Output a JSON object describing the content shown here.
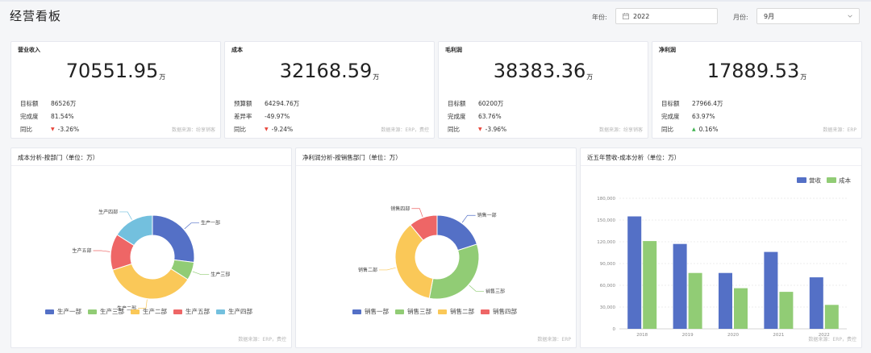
{
  "page": {
    "title": "经营看板"
  },
  "filters": {
    "year_label": "年份:",
    "year_value": "2022",
    "month_label": "月份:",
    "month_value": "9月"
  },
  "kpis": [
    {
      "title": "营业收入",
      "value": "70551.95",
      "unit": "万",
      "rows": [
        {
          "label": "目标额",
          "value": "86526万",
          "trend": ""
        },
        {
          "label": "完成度",
          "value": "81.54%",
          "trend": ""
        },
        {
          "label": "同比",
          "value": "-3.26%",
          "trend": "down"
        }
      ],
      "source": "数据来源：纷享销客"
    },
    {
      "title": "成本",
      "value": "32168.59",
      "unit": "万",
      "rows": [
        {
          "label": "预算额",
          "value": "64294.76万",
          "trend": ""
        },
        {
          "label": "差异率",
          "value": "-49.97%",
          "trend": ""
        },
        {
          "label": "同比",
          "value": "-9.24%",
          "trend": "down"
        }
      ],
      "source": "数据来源：ERP，费控"
    },
    {
      "title": "毛利润",
      "value": "38383.36",
      "unit": "万",
      "rows": [
        {
          "label": "目标额",
          "value": "60200万",
          "trend": ""
        },
        {
          "label": "完成度",
          "value": "63.76%",
          "trend": ""
        },
        {
          "label": "同比",
          "value": "-3.96%",
          "trend": "down"
        }
      ],
      "source": "数据来源：纷享销客"
    },
    {
      "title": "净利润",
      "value": "17889.53",
      "unit": "万",
      "rows": [
        {
          "label": "目标额",
          "value": "27966.4万",
          "trend": ""
        },
        {
          "label": "完成度",
          "value": "63.97%",
          "trend": ""
        },
        {
          "label": "同比",
          "value": "0.16%",
          "trend": "up"
        }
      ],
      "source": "数据来源：ERP"
    }
  ],
  "panels": {
    "cost": {
      "title": "成本分析-按部门（单位：万）",
      "source": "数据来源：ERP，费控"
    },
    "profit": {
      "title": "净利润分析-按销售部门（单位：万）",
      "source": "数据来源：ERP"
    },
    "trend": {
      "title": "近五年营收-成本分析（单位：万）",
      "source": "数据来源：ERP，费控"
    }
  },
  "chart_data": [
    {
      "type": "pie",
      "donut": true,
      "title": "成本分析-按部门（单位：万）",
      "labels": [
        "生产一部",
        "生产三部",
        "生产二部",
        "生产五部",
        "生产四部"
      ],
      "values": [
        27,
        7,
        36,
        14,
        16
      ],
      "colors": [
        "#5470c6",
        "#91cc75",
        "#fac858",
        "#ee6666",
        "#73c0de"
      ],
      "legend": "bottom"
    },
    {
      "type": "pie",
      "donut": true,
      "title": "净利润分析-按销售部门（单位：万）",
      "labels": [
        "销售一部",
        "销售三部",
        "销售二部",
        "销售四部"
      ],
      "values": [
        20,
        33,
        36,
        11
      ],
      "colors": [
        "#5470c6",
        "#91cc75",
        "#fac858",
        "#ee6666"
      ],
      "legend": "bottom"
    },
    {
      "type": "bar",
      "title": "近五年营收-成本分析（单位：万）",
      "categories": [
        "2018",
        "2019",
        "2020",
        "2021",
        "2022"
      ],
      "series": [
        {
          "name": "营收",
          "values": [
            155000,
            117000,
            77000,
            106000,
            71000
          ],
          "color": "#5470c6"
        },
        {
          "name": "成本",
          "values": [
            121000,
            77000,
            56000,
            51000,
            33000
          ],
          "color": "#91cc75"
        }
      ],
      "ylim": [
        0,
        180000
      ],
      "yticks": [
        "0",
        "30,000",
        "60,000",
        "90,000",
        "120,000",
        "150,000",
        "180,000"
      ],
      "legend": "top-right",
      "grid": true
    }
  ]
}
